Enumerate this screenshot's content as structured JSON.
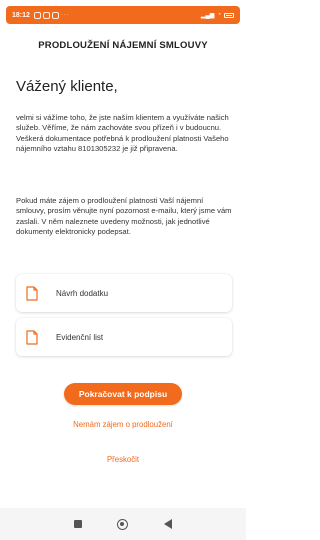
{
  "status_bar": {
    "time": "18:12",
    "notification_icons": [
      "notif-a",
      "notif-b",
      "notif-p"
    ],
    "right_icons": [
      "signal-icon",
      "wifi-icon",
      "battery-icon"
    ],
    "background_color": "#f26a1b"
  },
  "header": {
    "title": "PRODLOUŽENÍ NÁJEMNÍ SMLOUVY"
  },
  "body": {
    "greeting": "Vážený kliente,",
    "paragraph1": "velmi si vážíme toho, že jste naším klientem a využíváte našich služeb. Věříme, že nám zachováte svou přízeň i v budoucnu. Veškerá dokumentace potřebná k prodloužení platnosti Vašeho nájemního vztahu 8101305232 je již připravena.",
    "paragraph2": "Pokud máte zájem o prodloužení platnosti Vaší nájemní smlouvy, prosím věnujte nyní pozornost e-mailu, který jsme vám zaslali. V něm naleznete uvedeny možnosti, jak jednotlivé dokumenty elektronicky podepsat."
  },
  "documents": [
    {
      "label": "Návrh dodatku",
      "icon": "document-icon"
    },
    {
      "label": "Evidenční list",
      "icon": "document-icon"
    }
  ],
  "actions": {
    "primary": "Pokračovat k podpisu",
    "decline": "Nemám zájem o prodloužení",
    "skip": "Přeskočit"
  },
  "colors": {
    "accent": "#f26a1b",
    "text": "#222222"
  },
  "nav_bar": {
    "icons": [
      "recents-icon",
      "home-icon",
      "back-icon"
    ]
  }
}
